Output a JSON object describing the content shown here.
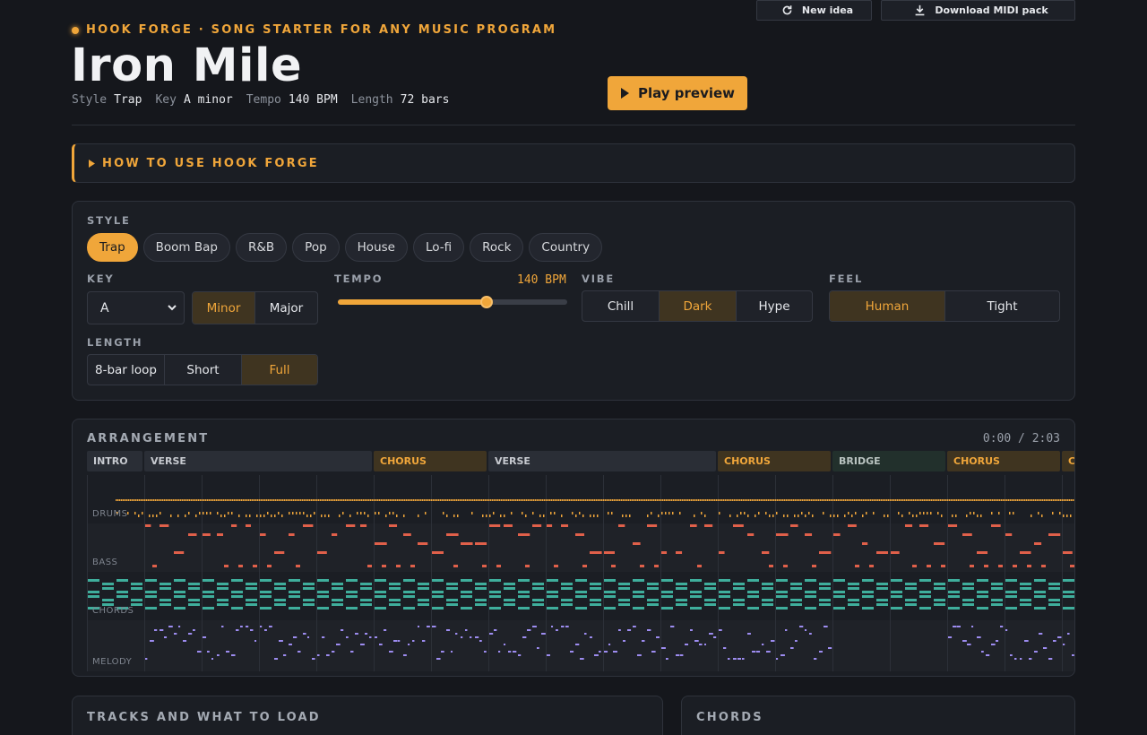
{
  "brand": {
    "text": "HOOK FORGE · SONG STARTER FOR ANY MUSIC PROGRAM"
  },
  "song": {
    "title": "Iron Mile",
    "meta": [
      {
        "key": "Style",
        "value": "Trap"
      },
      {
        "key": "Key",
        "value": "A minor"
      },
      {
        "key": "Tempo",
        "value": "140 BPM"
      },
      {
        "key": "Length",
        "value": "72 bars"
      }
    ]
  },
  "header_buttons": {
    "play": "Play preview",
    "new": "New idea",
    "download": "Download MIDI pack"
  },
  "howto": {
    "label": "HOW TO USE HOOK FORGE"
  },
  "controls": {
    "style_label": "STYLE",
    "styles": [
      "Trap",
      "Boom Bap",
      "R&B",
      "Pop",
      "House",
      "Lo-fi",
      "Rock",
      "Country"
    ],
    "style_selected": "Trap",
    "key_label": "KEY",
    "key_value": "A",
    "modes": [
      "Minor",
      "Major"
    ],
    "mode_selected": "Minor",
    "tempo_label": "TEMPO",
    "tempo_display": "140 BPM",
    "tempo_fraction": 0.65,
    "vibe_label": "VIBE",
    "vibes": [
      "Chill",
      "Dark",
      "Hype"
    ],
    "vibe_selected": "Dark",
    "feel_label": "FEEL",
    "feels": [
      "Human",
      "Tight"
    ],
    "feel_selected": "Human",
    "length_label": "LENGTH",
    "lengths": [
      "8-bar loop",
      "Short",
      "Full"
    ],
    "length_selected": "Full"
  },
  "arrangement": {
    "label": "ARRANGEMENT",
    "time": "0:00 / 2:03",
    "sections": [
      {
        "name": "INTRO",
        "kind": "verse",
        "bars": 4
      },
      {
        "name": "VERSE",
        "kind": "verse",
        "bars": 16
      },
      {
        "name": "CHORUS",
        "kind": "chorus",
        "bars": 8
      },
      {
        "name": "VERSE",
        "kind": "verse",
        "bars": 16
      },
      {
        "name": "CHORUS",
        "kind": "chorus",
        "bars": 8
      },
      {
        "name": "BRIDGE",
        "kind": "bridge",
        "bars": 8
      },
      {
        "name": "CHORUS",
        "kind": "chorus",
        "bars": 8
      },
      {
        "name": "CHORUS",
        "kind": "chorus",
        "bars": 8
      }
    ],
    "tracks": [
      {
        "name": "DRUMS",
        "color": "#f0a63a"
      },
      {
        "name": "BASS",
        "color": "#e0604a"
      },
      {
        "name": "CHORDS",
        "color": "#3fae9c"
      },
      {
        "name": "MELODY",
        "color": "#9d8cf0"
      }
    ]
  },
  "bottom": {
    "tracks_title": "TRACKS AND WHAT TO LOAD",
    "chords_title": "CHORDS"
  },
  "colors": {
    "accent": "#f0a63a",
    "background": "#15171c",
    "panel": "#1b1e24"
  }
}
